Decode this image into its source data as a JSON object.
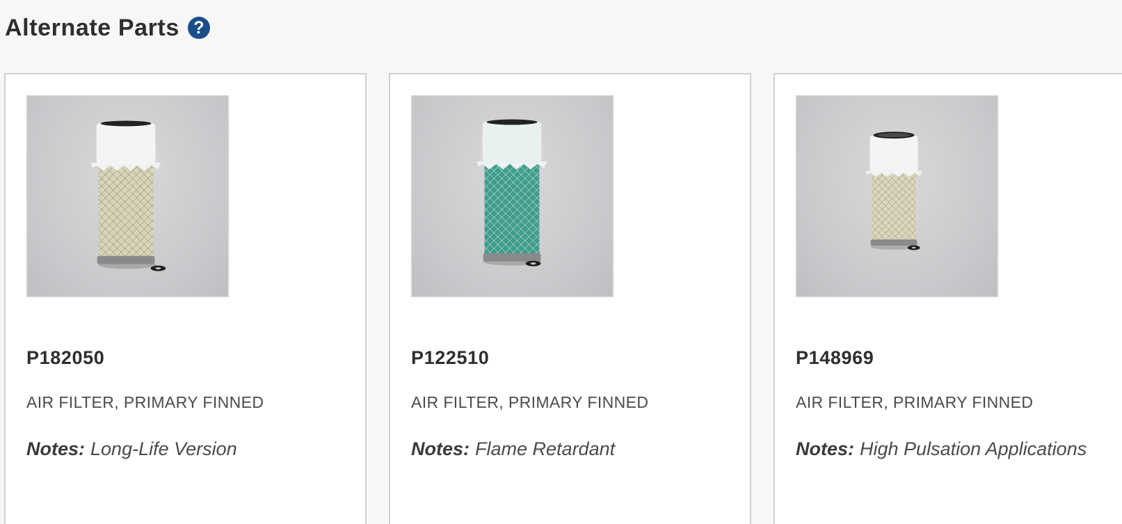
{
  "section": {
    "title": "Alternate Parts",
    "help_icon": "question-circle-icon",
    "help_icon_glyph": "?",
    "help_icon_color": "#1a4e8a"
  },
  "parts": [
    {
      "part_number": "P182050",
      "description": "AIR FILTER, PRIMARY FINNED",
      "notes_label": "Notes:",
      "notes_value": "Long-Life Version",
      "image": "air-filter-image",
      "media_color": "#d8d4b8"
    },
    {
      "part_number": "P122510",
      "description": "AIR FILTER, PRIMARY FINNED",
      "notes_label": "Notes:",
      "notes_value": "Flame Retardant",
      "image": "air-filter-image",
      "media_color": "#3f9d8c"
    },
    {
      "part_number": "P148969",
      "description": "AIR FILTER, PRIMARY FINNED",
      "notes_label": "Notes:",
      "notes_value": "High Pulsation Applications",
      "image": "air-filter-image",
      "media_color": "#dcd6bc"
    }
  ]
}
